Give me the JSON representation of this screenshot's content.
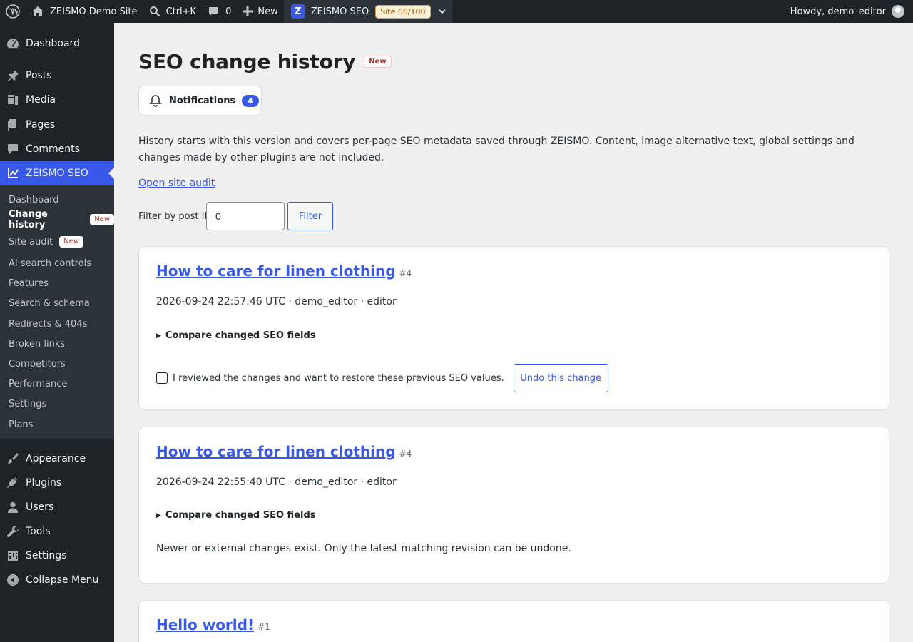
{
  "admin_bar": {
    "site_name": "ZEISMO Demo Site",
    "search_shortcut": "Ctrl+K",
    "comments_count": "0",
    "new_label": "New",
    "plugin_name": "ZEISMO SEO",
    "site_score": "Site 66/100",
    "greeting": "Howdy, demo_editor"
  },
  "sidebar": {
    "items": [
      {
        "label": "Dashboard",
        "icon": "dashboard-icon"
      },
      {
        "label": "Posts",
        "icon": "pin-icon"
      },
      {
        "label": "Media",
        "icon": "media-icon"
      },
      {
        "label": "Pages",
        "icon": "pages-icon"
      },
      {
        "label": "Comments",
        "icon": "comment-icon"
      },
      {
        "label": "ZEISMO SEO",
        "icon": "chart-icon"
      },
      {
        "label": "Appearance",
        "icon": "brush-icon"
      },
      {
        "label": "Plugins",
        "icon": "plug-icon"
      },
      {
        "label": "Users",
        "icon": "user-icon"
      },
      {
        "label": "Tools",
        "icon": "wrench-icon"
      },
      {
        "label": "Settings",
        "icon": "sliders-icon"
      },
      {
        "label": "Collapse Menu",
        "icon": "collapse-icon"
      }
    ],
    "submenu": [
      {
        "label": "Dashboard"
      },
      {
        "label": "Change history",
        "badge": "New"
      },
      {
        "label": "Site audit",
        "badge": "New"
      },
      {
        "label": "AI search controls"
      },
      {
        "label": "Features"
      },
      {
        "label": "Search & schema"
      },
      {
        "label": "Redirects & 404s"
      },
      {
        "label": "Broken links"
      },
      {
        "label": "Competitors"
      },
      {
        "label": "Performance"
      },
      {
        "label": "Settings"
      },
      {
        "label": "Plans"
      }
    ]
  },
  "main": {
    "title": "SEO change history",
    "title_badge": "New",
    "notifications_label": "Notifications",
    "notifications_count": "4",
    "intro": "History starts with this version and covers per-page SEO metadata saved through ZEISMO. Content, image alternative text, global settings and changes made by other plugins are not included.",
    "audit_link": "Open site audit",
    "filter_label": "Filter by post ID",
    "filter_value": "0",
    "filter_button": "Filter",
    "entries": [
      {
        "title": "How to care for linen clothing",
        "post_id": "#4",
        "meta": "2026-09-24 22:57:46 UTC · demo_editor · editor",
        "compare_label": "Compare changed SEO fields",
        "confirm_label": "I reviewed the changes and want to restore these previous SEO values.",
        "undo_label": "Undo this change"
      },
      {
        "title": "How to care for linen clothing",
        "post_id": "#4",
        "meta": "2026-09-24 22:55:40 UTC · demo_editor · editor",
        "compare_label": "Compare changed SEO fields",
        "note": "Newer or external changes exist. Only the latest matching revision can be undone."
      },
      {
        "title": "Hello world!",
        "post_id": "#1"
      }
    ]
  }
}
